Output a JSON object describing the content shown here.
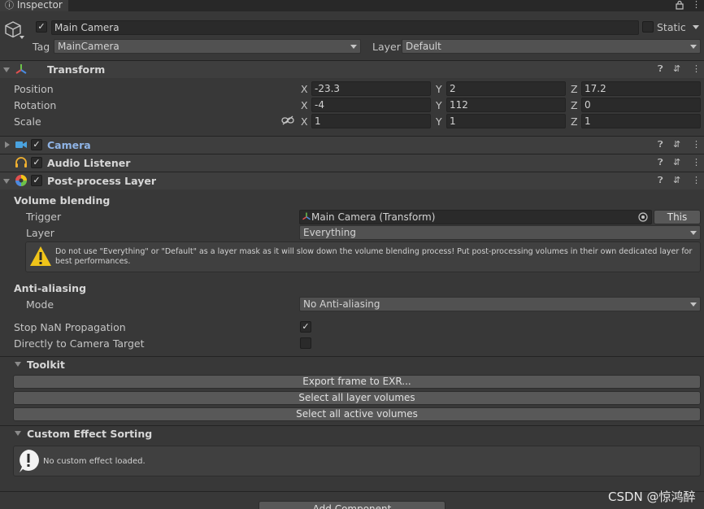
{
  "window": {
    "tab_label": "Inspector"
  },
  "object": {
    "name": "Main Camera",
    "static_label": "Static",
    "tag_label": "Tag",
    "tag_value": "MainCamera",
    "layer_label": "Layer",
    "layer_value": "Default"
  },
  "transform": {
    "title": "Transform",
    "rows": [
      {
        "label": "Position",
        "x": "-23.3",
        "y": "2",
        "z": "17.2"
      },
      {
        "label": "Rotation",
        "x": "-4",
        "y": "112",
        "z": "0"
      },
      {
        "label": "Scale",
        "x": "1",
        "y": "1",
        "z": "1"
      }
    ],
    "axis": {
      "x": "X",
      "y": "Y",
      "z": "Z"
    }
  },
  "components": {
    "camera": "Camera",
    "audio_listener": "Audio Listener",
    "post_process": "Post-process Layer"
  },
  "volume_blending": {
    "title": "Volume blending",
    "trigger_label": "Trigger",
    "trigger_value": "Main Camera (Transform)",
    "this_button": "This",
    "layer_label": "Layer",
    "layer_value": "Everything",
    "warning_text": "Do not use \"Everything\" or \"Default\" as a layer mask as it will slow down the volume blending process! Put post-processing volumes in their own dedicated layer for best performances."
  },
  "anti_aliasing": {
    "title": "Anti-aliasing",
    "mode_label": "Mode",
    "mode_value": "No Anti-aliasing",
    "stop_nan_label": "Stop NaN Propagation",
    "direct_target_label": "Directly to Camera Target"
  },
  "toolkit": {
    "title": "Toolkit",
    "buttons": [
      "Export frame to EXR...",
      "Select all layer volumes",
      "Select all active volumes"
    ]
  },
  "custom_sorting": {
    "title": "Custom Effect Sorting",
    "message": "No custom effect loaded."
  },
  "add_component_label": "Add Component",
  "watermark": "CSDN @惊鸿醉",
  "colors": {
    "background": "#383838",
    "field": "#2a2a2a",
    "camera_label": "#8fb4e6",
    "warning": "#f0c419"
  }
}
